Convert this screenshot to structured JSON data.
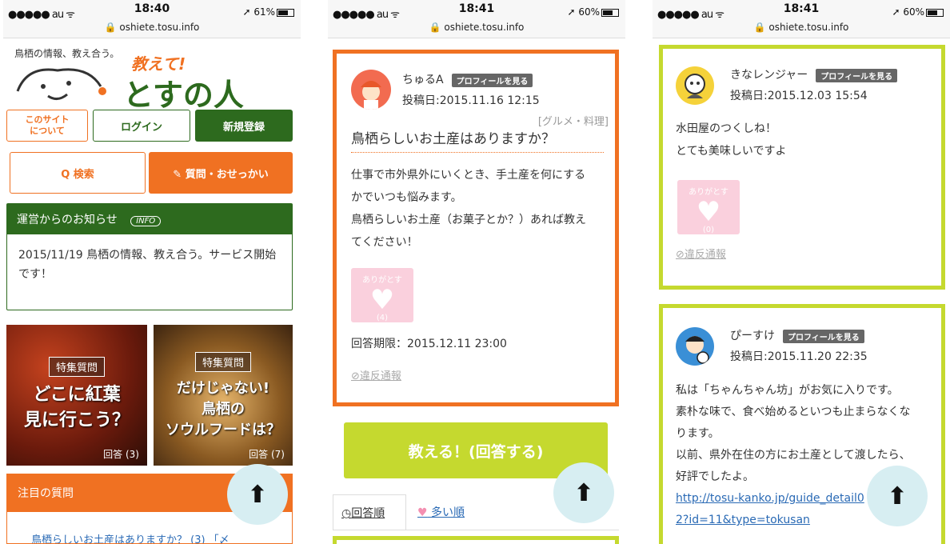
{
  "screens": [
    {
      "status": {
        "carrier": "●●●●● au ᯤ",
        "time": "18:40",
        "battery": "➚ 61%",
        "url": "🔒 oshiete.tosu.info"
      }
    },
    {
      "status": {
        "carrier": "●●●●● au ᯤ",
        "time": "18:41",
        "battery": "➚ 60%",
        "url": "🔒 oshiete.tosu.info"
      }
    },
    {
      "status": {
        "carrier": "●●●●● au ᯤ",
        "time": "18:41",
        "battery": "➚ 60%",
        "url": "🔒 oshiete.tosu.info"
      }
    }
  ],
  "home": {
    "tagline": "鳥栖の情報、教え合う。",
    "logo_script": "教えて!",
    "logo_main": "とすの人",
    "about_label": "このサイト\nについて",
    "login_label": "ログイン",
    "register_label": "新規登録",
    "search_label": "Q 検索",
    "ask_label": "✎ 質問・おせっかい",
    "notice_title": "運営からのお知らせ",
    "notice_badge": "INFO",
    "notice_text": "2015/11/19 鳥栖の情報、教え合う。サービス開始です！",
    "features": [
      {
        "tag": "特集質問",
        "line1": "どこに紅葉",
        "line2": "見に行こう？",
        "count": "回答 (3)"
      },
      {
        "tag": "特集質問",
        "line1": "だけじゃない!",
        "line2": "鳥栖の",
        "line3": "ソウルフードは？",
        "count": "回答 (7)"
      }
    ],
    "hot_title": "注目の質問",
    "hot_item": "鳥栖らしいお土産はありますか？ (3) 「〆"
  },
  "question": {
    "user": "ちゅるA",
    "profile_btn": "プロフィールを見る",
    "posted": "投稿日:2015.11.16 12:15",
    "category": "[グルメ・料理]",
    "title": "鳥栖らしいお土産はありますか？",
    "body": [
      "仕事で市外県外にいくとき、手土産を何にする",
      "かでいつも悩みます。",
      "鳥栖らしいお土産（お菓子とか？）あれば教え",
      "てください！"
    ],
    "thanks_label": "ありがとす",
    "thanks_count": "(4)",
    "deadline": "回答期限：2015.12.11 23:00",
    "report": "⊘違反通報",
    "answer_btn": "教える！(回答する)",
    "tab_order": "回答順",
    "tab_popular": "多い順"
  },
  "answers": [
    {
      "text": [
        "水田屋のつくしね！",
        "とても美味しいですよ"
      ],
      "thanks_label": "ありがとす",
      "thanks_count": "(0)",
      "report": "⊘違反通報"
    },
    {
      "user": "ぴーすけ",
      "profile_btn": "プロフィールを見る",
      "posted": "投稿日:2015.11.20 22:35",
      "text": [
        "私は「ちゃんちゃん坊」がお気に入りです。",
        "素朴な味で、食べ始めるといつも止まらなくな",
        "ります。",
        "以前、県外在住の方にお土産として渡したら、",
        "好評でしたよ。"
      ],
      "link": "http://tosu-kanko.jp/guide_detail02?id=11&type=tokusan"
    }
  ],
  "answer_top_user": "きなレンジャー",
  "answer_top_profile": "プロフィールを見る",
  "answer_top_posted": "投稿日:2015.12.03 15:54",
  "fab_icon": "arrow-up-icon",
  "colors": {
    "orange": "#f07122",
    "green": "#2d6a1e",
    "lime": "#c5d92f",
    "pink": "#fad0dd",
    "fab": "#d7eef2"
  }
}
